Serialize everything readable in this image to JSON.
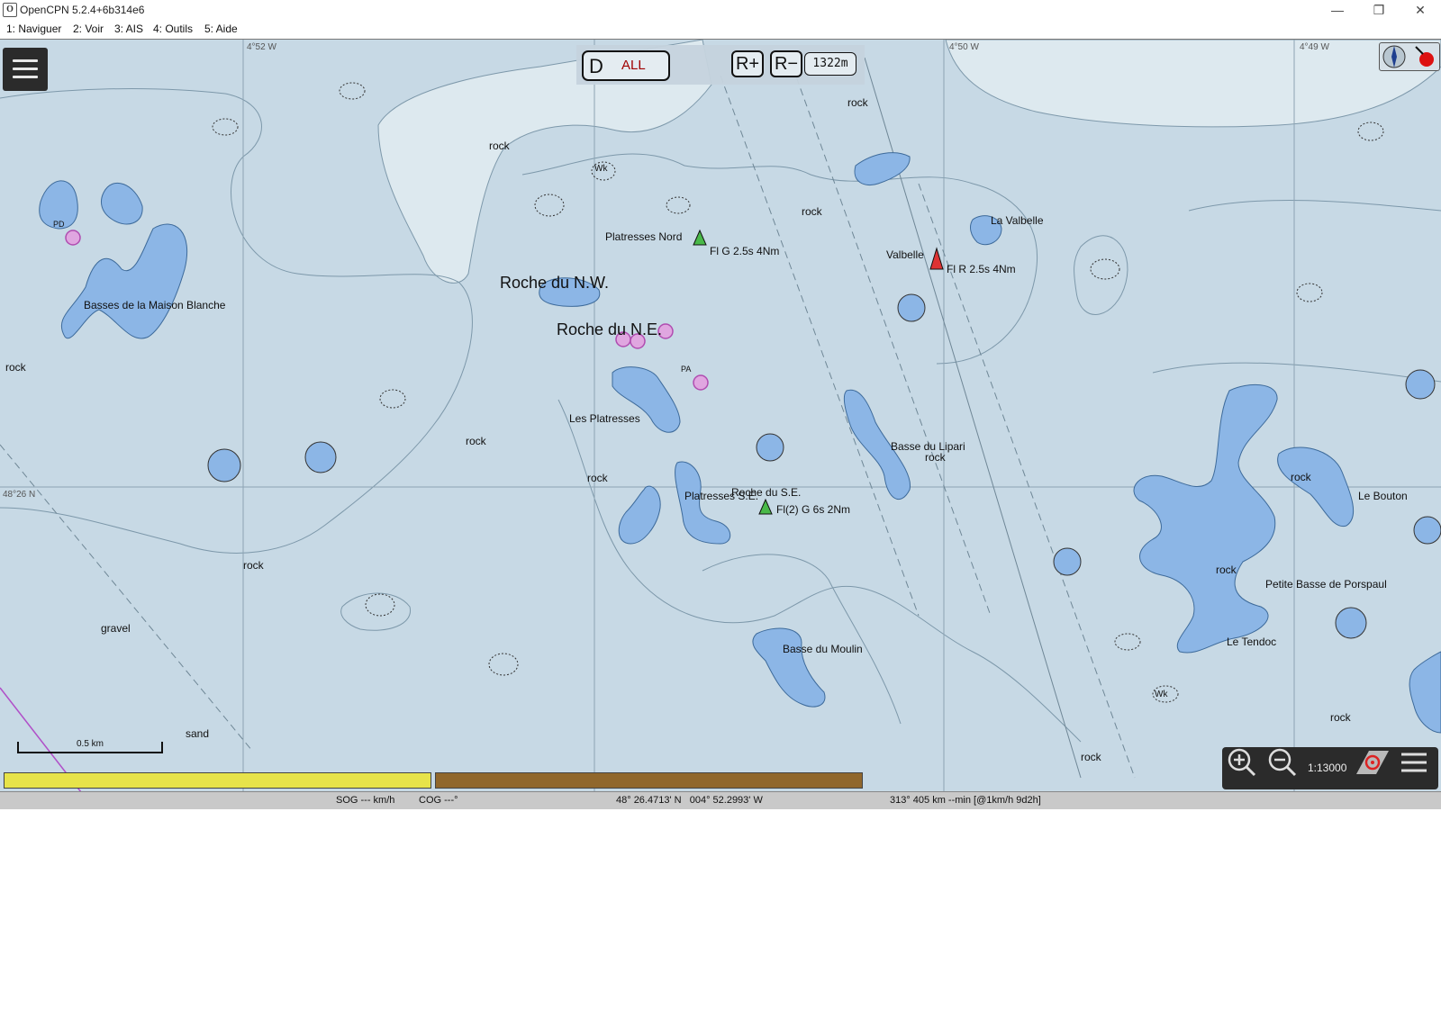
{
  "window": {
    "title": "OpenCPN 5.2.4+6b314e6",
    "minimize": "—",
    "maximize": "❐",
    "close": "✕"
  },
  "menu": [
    "1: Naviguer",
    "2: Voir",
    "3: AIS",
    "4: Outils",
    "5: Aide"
  ],
  "toolbar": {
    "piano_d": "D",
    "piano_all": "ALL",
    "r_plus": "R+",
    "r_minus": "R−",
    "range": "1322m"
  },
  "grid_labels": {
    "lon1": "4°52 W",
    "lon2": "4°50 W",
    "lon3": "4°49 W",
    "lat1": "48°26 N"
  },
  "labels": {
    "basses_maison_blanche": "Basses de la Maison Blanche",
    "roche_nw": "Roche du N.W.",
    "roche_ne": "Roche du N.E.",
    "platresses_nord": "Platresses Nord",
    "light_nord": "Fl G 2.5s 4Nm",
    "les_platresses": "Les Platresses",
    "platresses_se": "Platresses S.E.",
    "roche_se": "Roche du S.E.",
    "light_se": "Fl(2) G 6s 2Nm",
    "valbelle": "Valbelle",
    "la_valbelle": "La Valbelle",
    "light_valbelle": "Fl R 2.5s 4Nm",
    "basse_lipari": "Basse du Lipari",
    "le_bouton": "Le Bouton",
    "petite_basse": "Petite Basse de Porspaul",
    "le_tendoc": "Le Tendoc",
    "basse_moulin": "Basse du Moulin",
    "rock": "rock",
    "gravel": "gravel",
    "sand": "sand",
    "wk": "Wk",
    "pd": "PD",
    "pa": "PA"
  },
  "scalebar": {
    "label": "0.5 km"
  },
  "bottom_controls": {
    "scale": "1:13000"
  },
  "status": {
    "sog": "SOG --- km/h",
    "cog": "COG ---°",
    "position": "48° 26.4713' N   004° 52.2993' W",
    "route": "313°  405 km --min [@1km/h 9d2h]"
  },
  "colors": {
    "deep_water": "#c7d9e5",
    "shallow_water": "#d4e6ee",
    "drying": "#8cb6e6",
    "land_light": "#dde9ef"
  }
}
